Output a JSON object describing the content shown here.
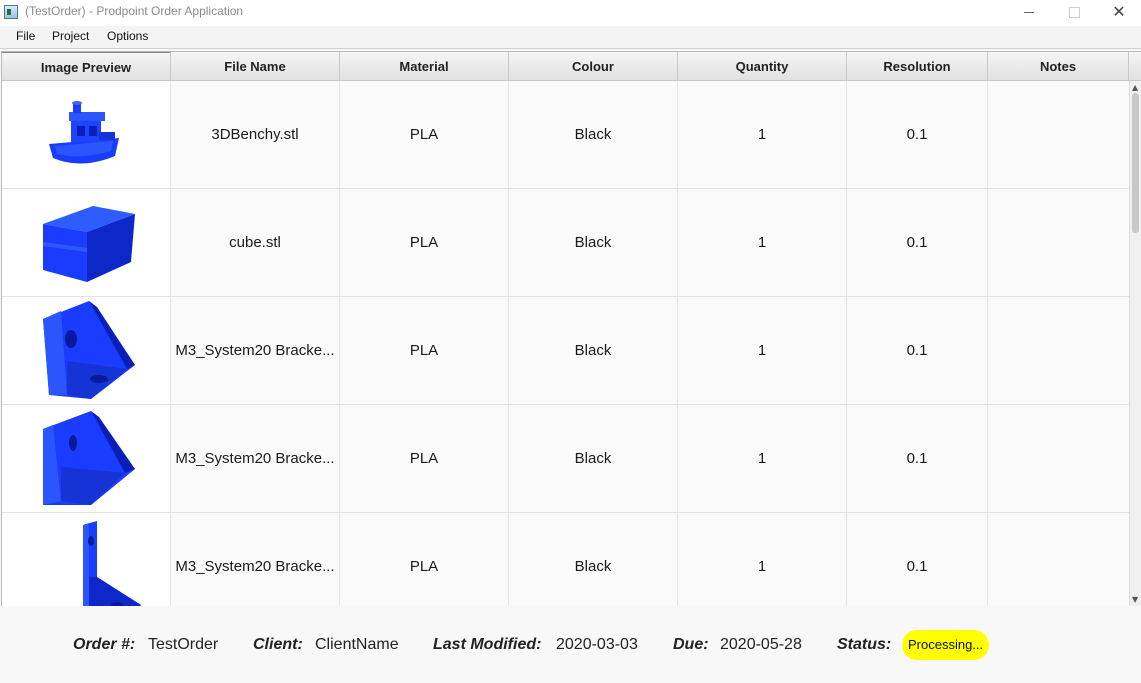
{
  "window": {
    "title": "(TestOrder) - Prodpoint Order Application"
  },
  "menu": [
    "File",
    "Project",
    "Options"
  ],
  "table": {
    "headers": [
      "Image Preview",
      "File Name",
      "Material",
      "Colour",
      "Quantity",
      "Resolution",
      "Notes"
    ],
    "rows": [
      {
        "preview": "benchy-model",
        "file_name": "3DBenchy.stl",
        "material": "PLA",
        "colour": "Black",
        "quantity": "1",
        "resolution": "0.1",
        "notes": ""
      },
      {
        "preview": "cube-model",
        "file_name": "cube.stl",
        "material": "PLA",
        "colour": "Black",
        "quantity": "1",
        "resolution": "0.1",
        "notes": ""
      },
      {
        "preview": "bracket-model",
        "file_name": "M3_System20 Bracke...",
        "material": "PLA",
        "colour": "Black",
        "quantity": "1",
        "resolution": "0.1",
        "notes": ""
      },
      {
        "preview": "bracket-model",
        "file_name": "M3_System20 Bracke...",
        "material": "PLA",
        "colour": "Black",
        "quantity": "1",
        "resolution": "0.1",
        "notes": ""
      },
      {
        "preview": "bracket-model",
        "file_name": "M3_System20 Bracke...",
        "material": "PLA",
        "colour": "Black",
        "quantity": "1",
        "resolution": "0.1",
        "notes": ""
      }
    ]
  },
  "footer": {
    "order_label": "Order #:",
    "order_value": "TestOrder",
    "client_label": "Client:",
    "client_value": "ClientName",
    "modified_label": "Last Modified:",
    "modified_value": "2020-03-03",
    "due_label": "Due:",
    "due_value": "2020-05-28",
    "status_label": "Status:",
    "status_value": "Processing..."
  },
  "colors": {
    "model_blue": "#1a3cff",
    "status_badge": "#ffff00"
  }
}
